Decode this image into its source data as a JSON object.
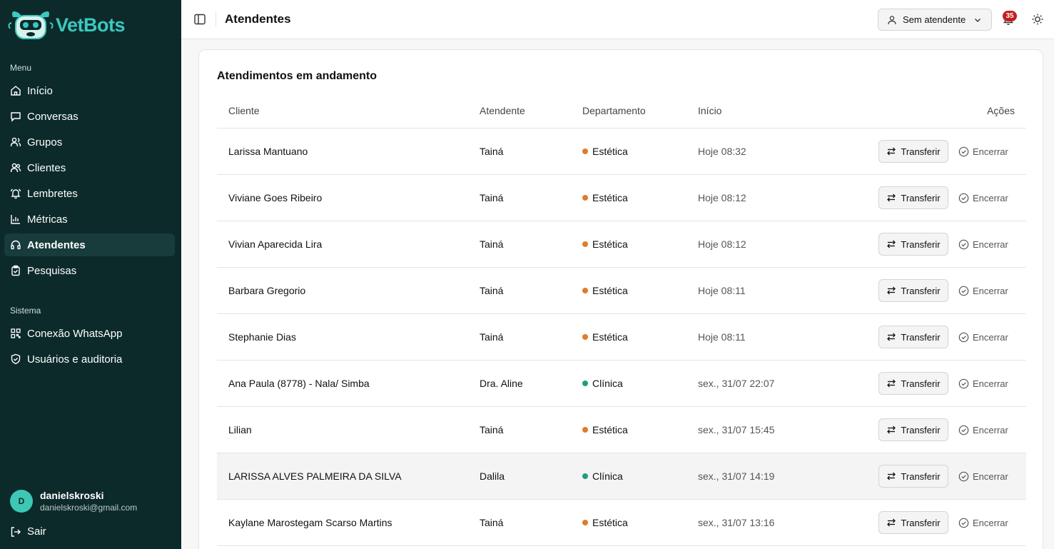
{
  "sidebar": {
    "brand": "VetBots",
    "menu_label": "Menu",
    "menu_items": [
      {
        "label": "Início",
        "icon": "home-icon"
      },
      {
        "label": "Conversas",
        "icon": "message-icon"
      },
      {
        "label": "Grupos",
        "icon": "user-group-icon"
      },
      {
        "label": "Clientes",
        "icon": "users-icon"
      },
      {
        "label": "Lembretes",
        "icon": "bell-ring-icon"
      },
      {
        "label": "Métricas",
        "icon": "bar-chart-icon"
      },
      {
        "label": "Atendentes",
        "icon": "headset-icon",
        "active": true
      },
      {
        "label": "Pesquisas",
        "icon": "clipboard-check-icon"
      }
    ],
    "system_label": "Sistema",
    "system_items": [
      {
        "label": "Conexão WhatsApp",
        "icon": "qr-code-icon"
      },
      {
        "label": "Usuários e auditoria",
        "icon": "shield-icon"
      }
    ],
    "user": {
      "initial": "D",
      "name": "danielskroski",
      "email": "danielskroski@gmail.com"
    },
    "logout": "Sair"
  },
  "header": {
    "title": "Atendentes",
    "attendant_select": "Sem atendente",
    "notifications": "35"
  },
  "main": {
    "card_title": "Atendimentos em andamento",
    "columns": {
      "client": "Cliente",
      "attendant": "Atendente",
      "department": "Departamento",
      "start": "Início",
      "actions": "Ações"
    },
    "transfer_label": "Transferir",
    "close_label": "Encerrar",
    "rows": [
      {
        "client": "Larissa Mantuano",
        "attendant": "Tainá",
        "department": "Estética",
        "start": "Hoje 08:32"
      },
      {
        "client": "Viviane Goes Ribeiro",
        "attendant": "Tainá",
        "department": "Estética",
        "start": "Hoje 08:12"
      },
      {
        "client": "Vivian Aparecida Lira",
        "attendant": "Tainá",
        "department": "Estética",
        "start": "Hoje 08:12"
      },
      {
        "client": "Barbara Gregorio",
        "attendant": "Tainá",
        "department": "Estética",
        "start": "Hoje 08:11"
      },
      {
        "client": "Stephanie Dias",
        "attendant": "Tainá",
        "department": "Estética",
        "start": "Hoje 08:11"
      },
      {
        "client": "Ana Paula (8778) - Nala/ Simba",
        "attendant": "Dra. Aline",
        "department": "Clínica",
        "start": "sex., 31/07 22:07"
      },
      {
        "client": "Lilian",
        "attendant": "Tainá",
        "department": "Estética",
        "start": "sex., 31/07 15:45"
      },
      {
        "client": "LARISSA ALVES PALMEIRA DA SILVA",
        "attendant": "Dalila",
        "department": "Clínica",
        "start": "sex., 31/07 14:19"
      },
      {
        "client": "Kaylane Marostegam Scarso Martins",
        "attendant": "Tainá",
        "department": "Estética",
        "start": "sex., 31/07 13:16"
      }
    ]
  },
  "colors": {
    "sidebar_bg": "#0c2a2a",
    "brand": "#3cc8c0",
    "estetica_dot": "#e07b2a",
    "clinica_dot": "#1f9e7e",
    "badge": "#c41e1e"
  }
}
